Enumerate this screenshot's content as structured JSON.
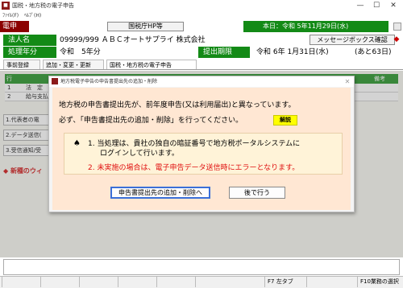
{
  "window": {
    "app_icon": "app-logo-icon",
    "title": "国税・地方税の電子申告",
    "menu": [
      "ﾌｧｲﾙ(F)",
      "ﾍﾙﾌﾟ(H)"
    ],
    "controls": [
      "—",
      "☐",
      "✕"
    ]
  },
  "status": {
    "mode": "電申",
    "hp_button": "国税庁HP等",
    "today": "本日：令和 5年11月29日(水)"
  },
  "header": {
    "corp_label": "法人名",
    "corp_value": "09999/999 ＡＢＣオートサプライ 株式会社",
    "message_button": "メッセージボックス確認",
    "fiscal_label": "処理年分",
    "fiscal_value": "令和　5年分",
    "deadline_label": "提出期限",
    "deadline_value": "令和 6年 1月31日(水)",
    "days_left": "(あと63日)"
  },
  "tabs": [
    "事前登録",
    "追加・変更・更新",
    "国税・地方税の電子申告"
  ],
  "background": {
    "col_row": "行",
    "col_remarks": "備考",
    "rows": [
      {
        "no": "1",
        "name": "法　定"
      },
      {
        "no": "2",
        "name": "給与支払"
      }
    ],
    "side_items": [
      "1.代表者の電",
      "2.データ送信(",
      "3.受信通知/受"
    ],
    "new_notice": "◆ 新種のウィ"
  },
  "dialog": {
    "title": "地方税電子申告の申告書提出先の追加・削除",
    "message1": "地方税の申告書提出先が、前年度申告(又は利用届出)と異なっています。",
    "message2": "必ず、「申告書提出先の追加・削除」を行ってください。",
    "help_button": "解説",
    "note_icon": "spade-icon",
    "note1_line1": "1. 当処理は、貴社の独自の暗証番号で地方税ポータルシステムに",
    "note1_line2": "ログインして行います。",
    "note2": "2. 未実施の場合は、電子申告データ送信時にエラーとなります。",
    "primary_button": "申告書提出先の追加・削除へ",
    "later_button": "後で行う"
  },
  "fkeys": [
    "F7 左タブ",
    "F10業務の選択"
  ],
  "colors": {
    "header_green": "#138a16",
    "mode_red": "#8b0000",
    "dialog_bg": "#ffe7d3",
    "warning_red": "#e01010",
    "help_yellow": "#ffff00"
  }
}
